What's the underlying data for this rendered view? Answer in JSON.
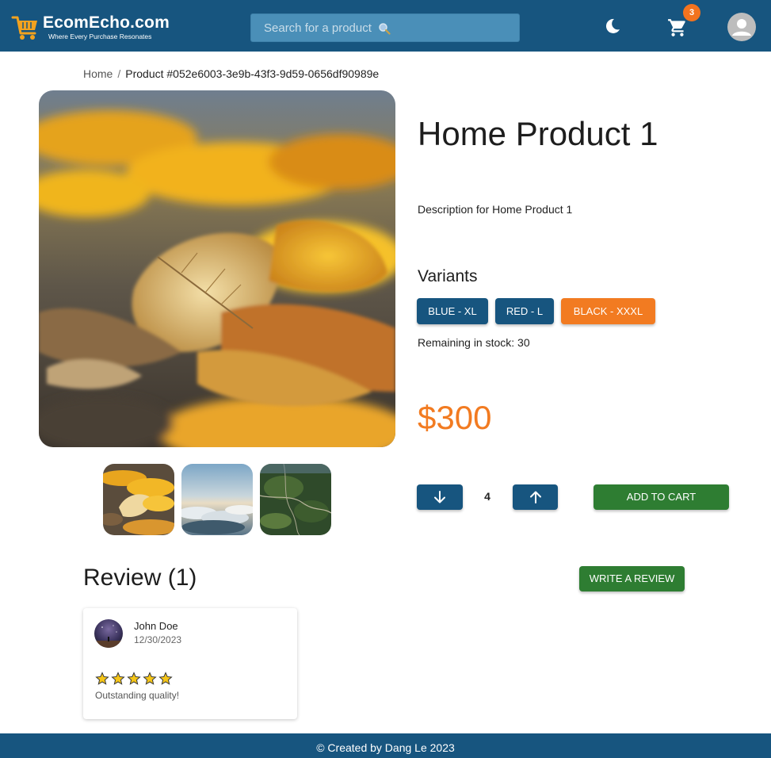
{
  "header": {
    "brand": "EcomEcho.com",
    "tagline": "Where Every Purchase Resonates",
    "search_placeholder": "Search for a product",
    "cart_count": "3",
    "icons": [
      "cart-logo-icon",
      "search-icon",
      "moon-icon",
      "shopping-cart-icon",
      "account-icon"
    ]
  },
  "breadcrumb": {
    "home": "Home",
    "separator": "/",
    "current": "Product #052e6003-3e9b-43f3-9d59-0656df90989e"
  },
  "product": {
    "title": "Home Product 1",
    "description": "Description for Home Product 1",
    "variants_heading": "Variants",
    "variants": [
      {
        "label": "BLUE - XL",
        "color": "#17557f"
      },
      {
        "label": "RED - L",
        "color": "#17557f"
      },
      {
        "label": "BLACK - XXXL",
        "color": "#f27b21",
        "selected": true
      }
    ],
    "stock": "Remaining in stock: 30",
    "price": "$300",
    "quantity": "4",
    "add_to_cart": "ADD TO CART"
  },
  "reviews": {
    "heading": "Review (1)",
    "write_button": "WRITE A REVIEW",
    "items": [
      {
        "name": "John Doe",
        "date": "12/30/2023",
        "rating": 5,
        "text": "Outstanding quality!"
      }
    ]
  },
  "footer": {
    "text": "© Created by Dang Le 2023"
  },
  "colors": {
    "primary": "#17557f",
    "accent": "#f27b21",
    "success": "#2e7d32"
  }
}
